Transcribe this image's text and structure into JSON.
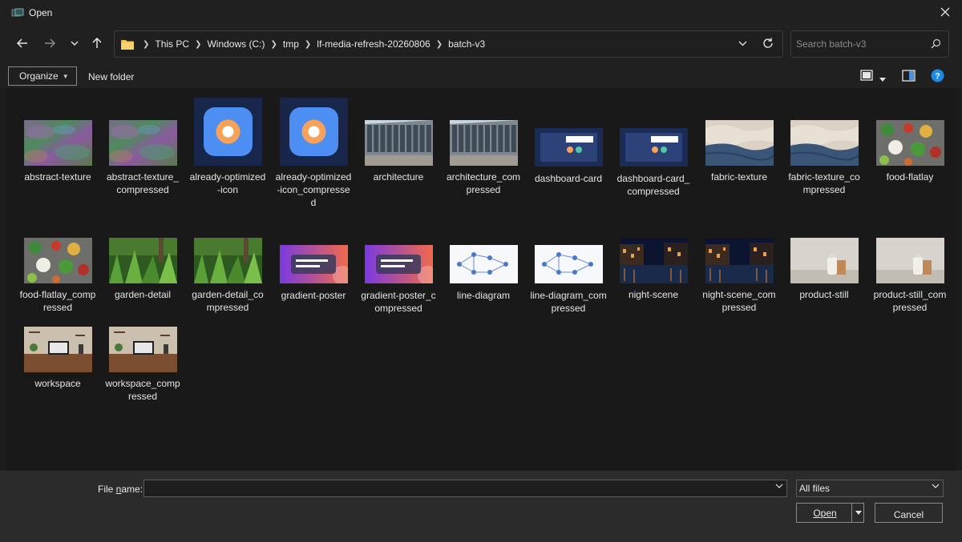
{
  "window": {
    "title": "Open"
  },
  "nav": {
    "breadcrumbs": [
      "This PC",
      "Windows (C:)",
      "tmp",
      "lf-media-refresh-20260806",
      "batch-v3"
    ],
    "search_placeholder": "Search batch-v3"
  },
  "toolbar": {
    "organize_label": "Organize",
    "new_folder_label": "New folder"
  },
  "files": [
    {
      "name": "abstract-texture",
      "thumb": "abstract"
    },
    {
      "name": "abstract-texture_compressed",
      "thumb": "abstract"
    },
    {
      "name": "already-optimized-icon",
      "thumb": "icon"
    },
    {
      "name": "already-optimized-icon_compressed",
      "thumb": "icon"
    },
    {
      "name": "architecture",
      "thumb": "architecture"
    },
    {
      "name": "architecture_compressed",
      "thumb": "architecture"
    },
    {
      "name": "dashboard-card",
      "thumb": "dashboard"
    },
    {
      "name": "dashboard-card_compressed",
      "thumb": "dashboard"
    },
    {
      "name": "fabric-texture",
      "thumb": "fabric"
    },
    {
      "name": "fabric-texture_compressed",
      "thumb": "fabric"
    },
    {
      "name": "food-flatlay",
      "thumb": "food"
    },
    {
      "name": "food-flatlay_compressed",
      "thumb": "food"
    },
    {
      "name": "garden-detail",
      "thumb": "garden"
    },
    {
      "name": "garden-detail_compressed",
      "thumb": "garden"
    },
    {
      "name": "gradient-poster",
      "thumb": "poster"
    },
    {
      "name": "gradient-poster_compressed",
      "thumb": "poster"
    },
    {
      "name": "line-diagram",
      "thumb": "diagram"
    },
    {
      "name": "line-diagram_compressed",
      "thumb": "diagram"
    },
    {
      "name": "night-scene",
      "thumb": "night"
    },
    {
      "name": "night-scene_compressed",
      "thumb": "night"
    },
    {
      "name": "product-still",
      "thumb": "product"
    },
    {
      "name": "product-still_compressed",
      "thumb": "product"
    },
    {
      "name": "workspace",
      "thumb": "workspace"
    },
    {
      "name": "workspace_compressed",
      "thumb": "workspace"
    }
  ],
  "footer": {
    "file_name_label_pre": "File ",
    "file_name_label_u": "n",
    "file_name_label_post": "ame:",
    "file_name_value": "",
    "filter_value": "All files",
    "open_label": "Open",
    "cancel_label": "Cancel"
  },
  "colors": {
    "accent": "#4a90e2",
    "help": "#1e88e5",
    "folder": "#f2c14e",
    "content_bg": "#191919",
    "chrome_bg": "#202020"
  }
}
